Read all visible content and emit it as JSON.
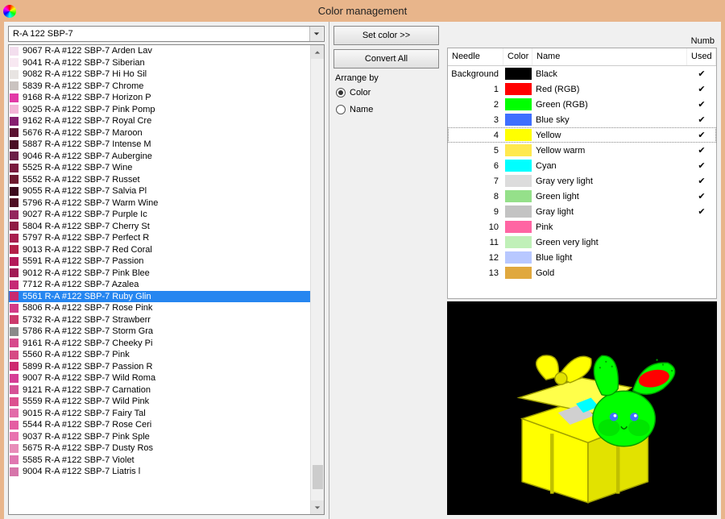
{
  "window": {
    "title": "Color management",
    "numb_label": "Numb"
  },
  "dropdown": {
    "value": "R-A 122 SBP-7"
  },
  "palette": [
    {
      "code": "9067 R-A #122 SBP-7 Arden Lav",
      "hex": "#f3deee"
    },
    {
      "code": "9041 R-A #122 SBP-7 Siberian",
      "hex": "#f8e8f2"
    },
    {
      "code": "9082 R-A #122 SBP-7 Hi Ho Sil",
      "hex": "#e8e4e2"
    },
    {
      "code": "5839 R-A #122 SBP-7 Chrome",
      "hex": "#cac3c0"
    },
    {
      "code": "9168 R-A #122 SBP-7 Horizon P",
      "hex": "#e23aa7"
    },
    {
      "code": "9025 R-A #122 SBP-7 Pink Pomp",
      "hex": "#f3b3d6"
    },
    {
      "code": "9162 R-A #122 SBP-7 Royal Cre",
      "hex": "#861f6f"
    },
    {
      "code": "5676 R-A #122 SBP-7 Maroon",
      "hex": "#5b1231"
    },
    {
      "code": "5887 R-A #122 SBP-7 Intense M",
      "hex": "#4a0d24"
    },
    {
      "code": "9046 R-A #122 SBP-7 Aubergine",
      "hex": "#6c2048"
    },
    {
      "code": "5525 R-A #122 SBP-7 Wine",
      "hex": "#7a1a3e"
    },
    {
      "code": "5552 R-A #122 SBP-7 Russet",
      "hex": "#6e1a30"
    },
    {
      "code": "9055 R-A #122 SBP-7 Salvia Pl",
      "hex": "#3d0a1e"
    },
    {
      "code": "5796 R-A #122 SBP-7 Warm Wine",
      "hex": "#4f0e24"
    },
    {
      "code": "9027 R-A #122 SBP-7 Purple Ic",
      "hex": "#93265d"
    },
    {
      "code": "5804 R-A #122 SBP-7 Cherry St",
      "hex": "#8f1c44"
    },
    {
      "code": "5797 R-A #122 SBP-7 Perfect R",
      "hex": "#a81e4e"
    },
    {
      "code": "9013 R-A #122 SBP-7 Red Coral",
      "hex": "#b42048"
    },
    {
      "code": "5591 R-A #122 SBP-7 Passion",
      "hex": "#b31a59"
    },
    {
      "code": "9012 R-A #122 SBP-7 Pink Blee",
      "hex": "#a11c55"
    },
    {
      "code": "7712 R-A #122 SBP-7 Azalea",
      "hex": "#c62a75"
    },
    {
      "code": "5561 R-A #122 SBP-7 Ruby Glin",
      "hex": "#c82a6f",
      "sel": true
    },
    {
      "code": "5806 R-A #122 SBP-7 Rose Pink",
      "hex": "#d33b87"
    },
    {
      "code": "5732 R-A #122 SBP-7 Strawberr",
      "hex": "#cc3a6c"
    },
    {
      "code": "5786 R-A #122 SBP-7 Storm Gra",
      "hex": "#8a8a8a"
    },
    {
      "code": "9161 R-A #122 SBP-7 Cheeky Pi",
      "hex": "#d64a8c"
    },
    {
      "code": "5560 R-A #122 SBP-7 Pink",
      "hex": "#d64a84"
    },
    {
      "code": "5899 R-A #122 SBP-7 Passion R",
      "hex": "#ce2a6f"
    },
    {
      "code": "9007 R-A #122 SBP-7 Wild Roma",
      "hex": "#d63e95"
    },
    {
      "code": "9121 R-A #122 SBP-7 Carnation",
      "hex": "#d65296"
    },
    {
      "code": "5559 R-A #122 SBP-7 Wild Pink",
      "hex": "#dc508f"
    },
    {
      "code": "9015 R-A #122 SBP-7 Fairy Tal",
      "hex": "#e26ba9"
    },
    {
      "code": "5544 R-A #122 SBP-7 Rose Ceri",
      "hex": "#e45ea2"
    },
    {
      "code": "9037 R-A #122 SBP-7 Pink Sple",
      "hex": "#e873af"
    },
    {
      "code": "5675 R-A #122 SBP-7 Dusty Ros",
      "hex": "#e88db9"
    },
    {
      "code": "5585 R-A #122 SBP-7 Violet",
      "hex": "#e077b1"
    },
    {
      "code": "9004 R-A #122 SBP-7 Liatris l",
      "hex": "#d675aa"
    }
  ],
  "buttons": {
    "set_color": "Set color >>",
    "convert_all": "Convert All"
  },
  "arrange": {
    "label": "Arrange by",
    "opt_color": "Color",
    "opt_name": "Name",
    "selected": "color"
  },
  "table": {
    "headers": {
      "needle": "Needle",
      "color": "Color",
      "name": "Name",
      "used": "Used"
    },
    "background_label": "Background",
    "rows": [
      {
        "needle": "Background",
        "hex": "#000000",
        "name": "Black",
        "used": true
      },
      {
        "needle": "1",
        "hex": "#ff0000",
        "name": "Red (RGB)",
        "used": true
      },
      {
        "needle": "2",
        "hex": "#00ff00",
        "name": "Green (RGB)",
        "used": true
      },
      {
        "needle": "3",
        "hex": "#3f6fff",
        "name": "Blue sky",
        "used": true
      },
      {
        "needle": "4",
        "hex": "#ffff00",
        "name": "Yellow",
        "used": true,
        "focus": true
      },
      {
        "needle": "5",
        "hex": "#ffe94e",
        "name": "Yellow warm",
        "used": true
      },
      {
        "needle": "6",
        "hex": "#00ffff",
        "name": "Cyan",
        "used": true
      },
      {
        "needle": "7",
        "hex": "#dcdcdc",
        "name": "Gray very light",
        "used": true
      },
      {
        "needle": "8",
        "hex": "#95e08a",
        "name": "Green light",
        "used": true
      },
      {
        "needle": "9",
        "hex": "#c3c3c3",
        "name": "Gray light",
        "used": true
      },
      {
        "needle": "10",
        "hex": "#ff65a3",
        "name": "Pink",
        "used": false
      },
      {
        "needle": "11",
        "hex": "#c0f0b8",
        "name": "Green very light",
        "used": false
      },
      {
        "needle": "12",
        "hex": "#b8c8ff",
        "name": "Blue light",
        "used": false
      },
      {
        "needle": "13",
        "hex": "#e0a83e",
        "name": "Gold",
        "used": false
      }
    ]
  }
}
